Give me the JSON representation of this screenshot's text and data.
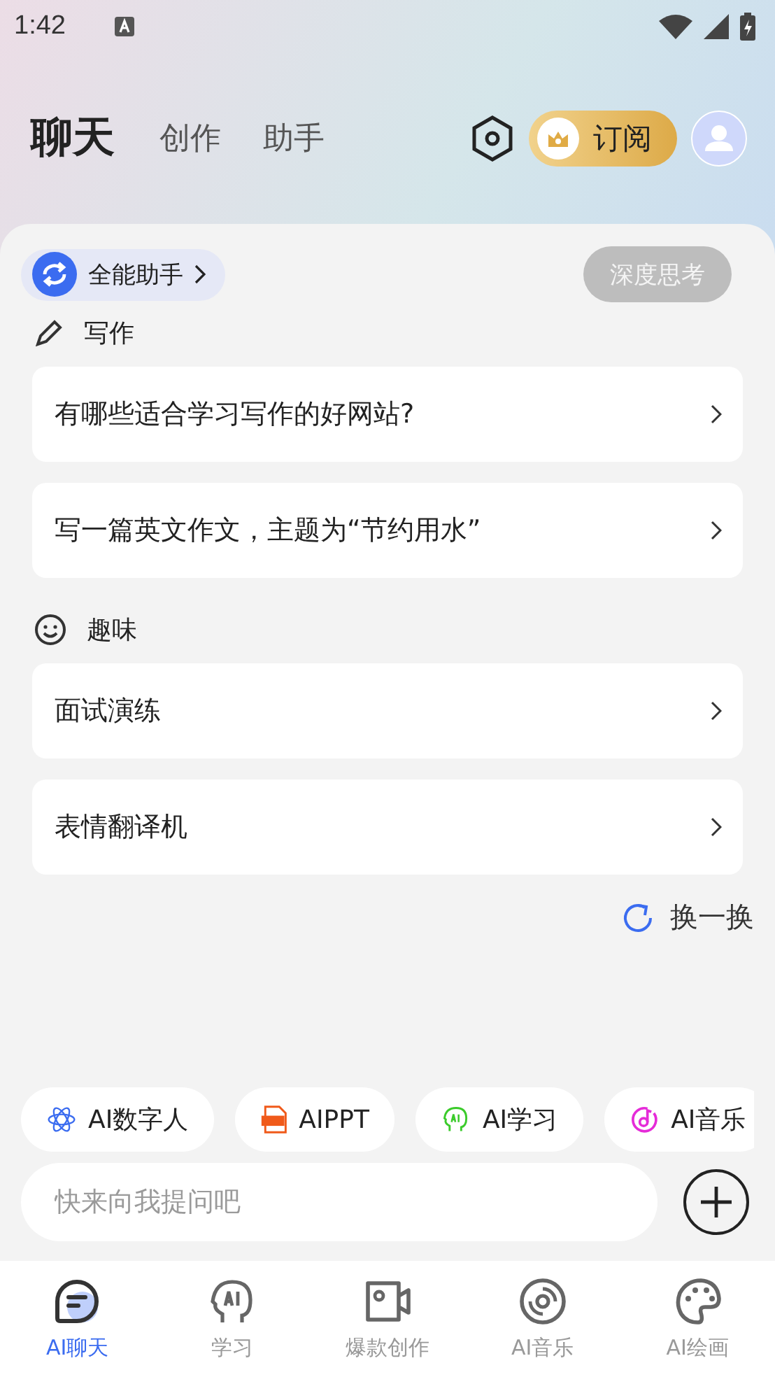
{
  "status_bar": {
    "time": "1:42"
  },
  "top_tabs": [
    {
      "label": "聊天",
      "selected": true
    },
    {
      "label": "创作",
      "selected": false
    },
    {
      "label": "助手",
      "selected": false
    }
  ],
  "subscribe_button": {
    "label": "订阅"
  },
  "assistant_selector": {
    "label": "全能助手"
  },
  "deep_think_button": {
    "label": "深度思考",
    "on": false
  },
  "sections": [
    {
      "kind": "pen",
      "title": "写作",
      "prompts": [
        "有哪些适合学习写作的好网站?",
        "写一篇英文作文，主题为“节约用水”"
      ]
    },
    {
      "kind": "smile",
      "title": "趣味",
      "prompts": [
        "面试演练",
        "表情翻译机"
      ]
    }
  ],
  "refresh_button": {
    "label": "换一换"
  },
  "quick_chips": [
    {
      "kind": "atom",
      "label": "AI数字人"
    },
    {
      "kind": "ppt",
      "label": "AIPPT"
    },
    {
      "kind": "head",
      "label": "AI学习"
    },
    {
      "kind": "music",
      "label": "AI音乐"
    }
  ],
  "input": {
    "placeholder": "快来向我提问吧"
  },
  "bottom_nav": [
    {
      "kind": "chat",
      "label": "AI聊天",
      "selected": true
    },
    {
      "kind": "head",
      "label": "学习",
      "selected": false
    },
    {
      "kind": "video",
      "label": "爆款创作",
      "selected": false
    },
    {
      "kind": "disc",
      "label": "AI音乐",
      "selected": false
    },
    {
      "kind": "palette",
      "label": "AI绘画",
      "selected": false
    }
  ]
}
